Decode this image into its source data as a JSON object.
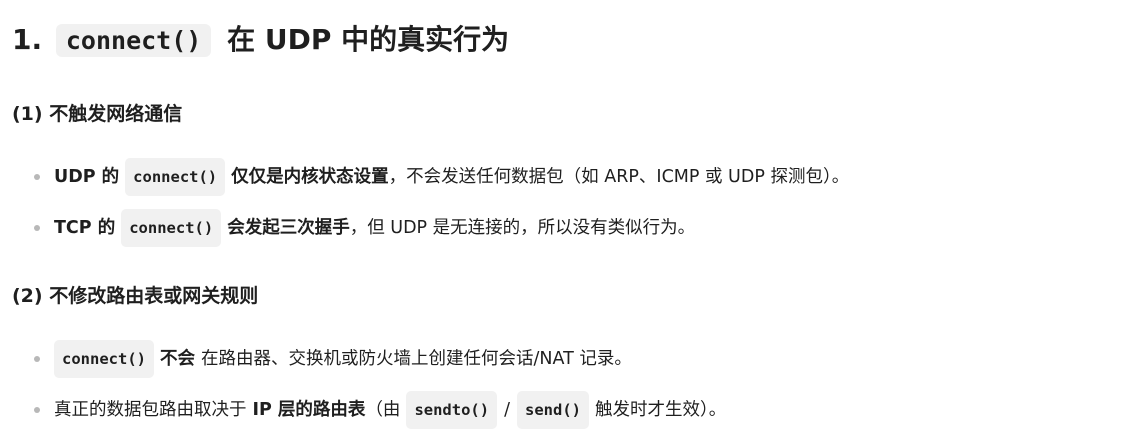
{
  "heading": {
    "number": "1.",
    "code": "connect()",
    "text": "在 UDP 中的真实行为"
  },
  "sections": [
    {
      "title": "(1) 不触发网络通信",
      "items": [
        {
          "bold_pre": "UDP 的",
          "code": "connect()",
          "bold_post": "仅仅是内核状态设置",
          "rest": "，不会发送任何数据包（如 ARP、ICMP 或 UDP 探测包）。"
        },
        {
          "bold_pre": "TCP 的",
          "code": "connect()",
          "bold_post": "会发起三次握手",
          "rest": "，但 UDP 是无连接的，所以没有类似行为。"
        }
      ]
    },
    {
      "title": "(2) 不修改路由表或网关规则",
      "items": [
        {
          "code": "connect()",
          "bold": "不会",
          "rest": "在路由器、交换机或防火墙上创建任何会话/NAT 记录。"
        },
        {
          "pre": "真正的数据包路由取决于",
          "bold": "IP 层的路由表",
          "mid": "（由",
          "code1": "sendto()",
          "sep": "/",
          "code2": "send()",
          "rest": "触发时才生效）。"
        }
      ]
    }
  ]
}
